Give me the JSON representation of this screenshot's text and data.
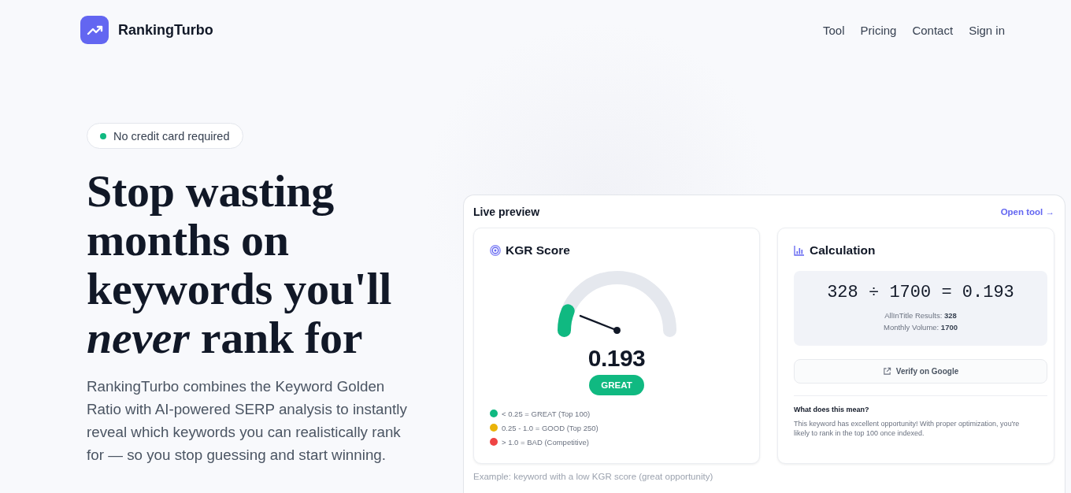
{
  "header": {
    "brand": "RankingTurbo",
    "nav": [
      "Tool",
      "Pricing",
      "Contact",
      "Sign in"
    ]
  },
  "hero": {
    "badge": "No credit card required",
    "headline": "Stop wasting months on keywords you'll *never* rank for",
    "description": "RankingTurbo combines the Keyword Golden Ratio with AI-powered SERP analysis to instantly reveal which keywords you can realistically rank for — so you stop guessing and start winning."
  },
  "preview": {
    "title": "Live preview",
    "link": "Open tool →",
    "score_card": {
      "title": "KGR Score",
      "gauge": {
        "level": 0.12
      },
      "score": "0.193",
      "rating": "GREAT",
      "legend": [
        {
          "label": "< 0.25 = GREAT (Top 100)",
          "color": "#10b981"
        },
        {
          "label": "0.25 - 1.0 = GOOD (Top 250)",
          "color": "#eab308"
        },
        {
          "label": "> 1.0 = BAD (Competitive)",
          "color": "#ef4444"
        }
      ]
    },
    "calculation_card": {
      "title": "Calculation",
      "formula": "328 ÷ 1700 = 0.193",
      "details": [
        "AllInTitle Results: **328**",
        "Monthly Volume: **1700**"
      ],
      "button": "Verify on Google",
      "explanation_title": "What does this mean?",
      "explanation": "This keyword has excellent opportunity! With proper optimization, you're likely to rank in the top 100 once indexed."
    },
    "caption": "Example: keyword with a low KGR score (great opportunity)"
  }
}
